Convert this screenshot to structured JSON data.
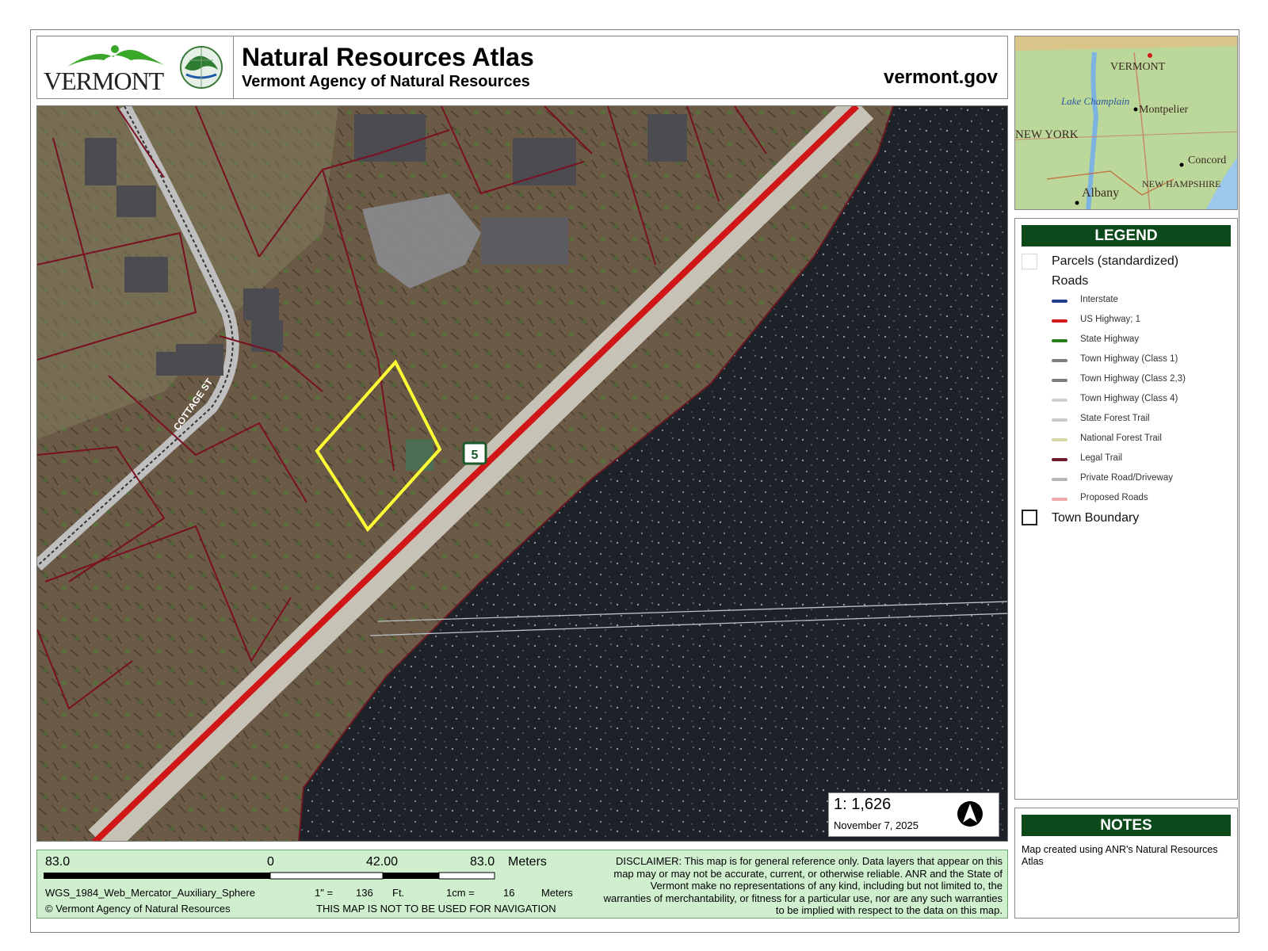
{
  "header": {
    "logo_text": "VERMONT",
    "title": "Natural Resources Atlas",
    "subtitle": "Vermont Agency of Natural Resources",
    "site": "vermont.gov"
  },
  "map": {
    "street_label": "COTTAGE ST",
    "route_shield": "5"
  },
  "inset": {
    "labels": [
      "VERMONT",
      "Lake Champlain",
      "Montpelier",
      "NEW YORK",
      "Concord",
      "NEW HAMPSHIRE",
      "Albany"
    ]
  },
  "legend": {
    "title": "LEGEND",
    "parcels": "Parcels (standardized)",
    "roads_header": "Roads",
    "roads": [
      {
        "label": "Interstate",
        "color": "#1f3f8a"
      },
      {
        "label": "US Highway; 1",
        "color": "#d11a1a"
      },
      {
        "label": "State Highway",
        "color": "#2a7a1e"
      },
      {
        "label": "Town Highway (Class 1)",
        "color": "#7d7d7d"
      },
      {
        "label": "Town Highway (Class 2,3)",
        "color": "#7d7d7d"
      },
      {
        "label": "Town Highway (Class 4)",
        "color": "#d0d0d0"
      },
      {
        "label": "State Forest Trail",
        "color": "#c9c9c9"
      },
      {
        "label": "National Forest Trail",
        "color": "#d6d6a8"
      },
      {
        "label": "Legal Trail",
        "color": "#6a1a2a"
      },
      {
        "label": "Private Road/Driveway",
        "color": "#b5b5b5"
      },
      {
        "label": "Proposed Roads",
        "color": "#f0a8a8"
      }
    ],
    "town_boundary": "Town Boundary"
  },
  "notes": {
    "title": "NOTES",
    "text": "Map created using ANR's Natural Resources Atlas"
  },
  "scale": {
    "ratio": "1:  1,626",
    "date": "November 7, 2025"
  },
  "scalebar": {
    "left": "83.0",
    "zero": "0",
    "mid": "42.00",
    "right": "83.0",
    "units": "Meters",
    "projection": "WGS_1984_Web_Mercator_Auxiliary_Sphere",
    "copyright": "© Vermont Agency of Natural Resources",
    "inch_label": "1\" =",
    "inch_value": "136",
    "inch_units": "Ft.",
    "cm_label": "1cm =",
    "cm_value": "16",
    "cm_units": "Meters",
    "nav_warning": "THIS MAP IS NOT TO BE USED FOR NAVIGATION",
    "disclaimer": "DISCLAIMER: This map is for general reference only. Data layers that appear on this map may or may not be accurate, current, or otherwise reliable. ANR and the State of Vermont make no representations of any kind, including but not limited to, the warranties of merchantability, or fitness for a particular use, nor are any such warranties to be implied with respect to the data on this map."
  }
}
